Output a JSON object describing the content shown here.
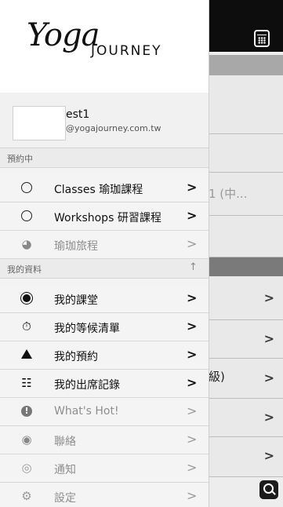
{
  "background": {
    "row_texts": [
      "1 (中...",
      "級)"
    ]
  },
  "drawer": {
    "logo": {
      "script": "Yoga",
      "word": "JOURNEY"
    },
    "user": {
      "name": "est1",
      "email": "@yogajourney.com.tw"
    },
    "sections": {
      "booking": "預約中",
      "my_data": "我的資料"
    },
    "booking_items": [
      {
        "label": "Classes 瑜珈課程",
        "icon": "radio-icon"
      },
      {
        "label": "Workshops 研習課程",
        "icon": "radio-icon"
      },
      {
        "label": "瑜珈旅程",
        "icon": "globe-icon"
      }
    ],
    "my_items": [
      {
        "label": "我的課堂",
        "icon": "target-icon"
      },
      {
        "label": "我的等候清單",
        "icon": "stopwatch-icon"
      },
      {
        "label": "我的預約",
        "icon": "warning-triangle-icon"
      },
      {
        "label": "我的出席記錄",
        "icon": "checklist-icon"
      },
      {
        "label": "What's Hot!",
        "icon": "exclamation-icon"
      },
      {
        "label": "聯絡",
        "icon": "location-pin-icon"
      },
      {
        "label": "通知",
        "icon": "chat-bubble-icon"
      },
      {
        "label": "設定",
        "icon": "gear-icon"
      }
    ],
    "chevron": ">",
    "collapse_symbol": "↑"
  }
}
